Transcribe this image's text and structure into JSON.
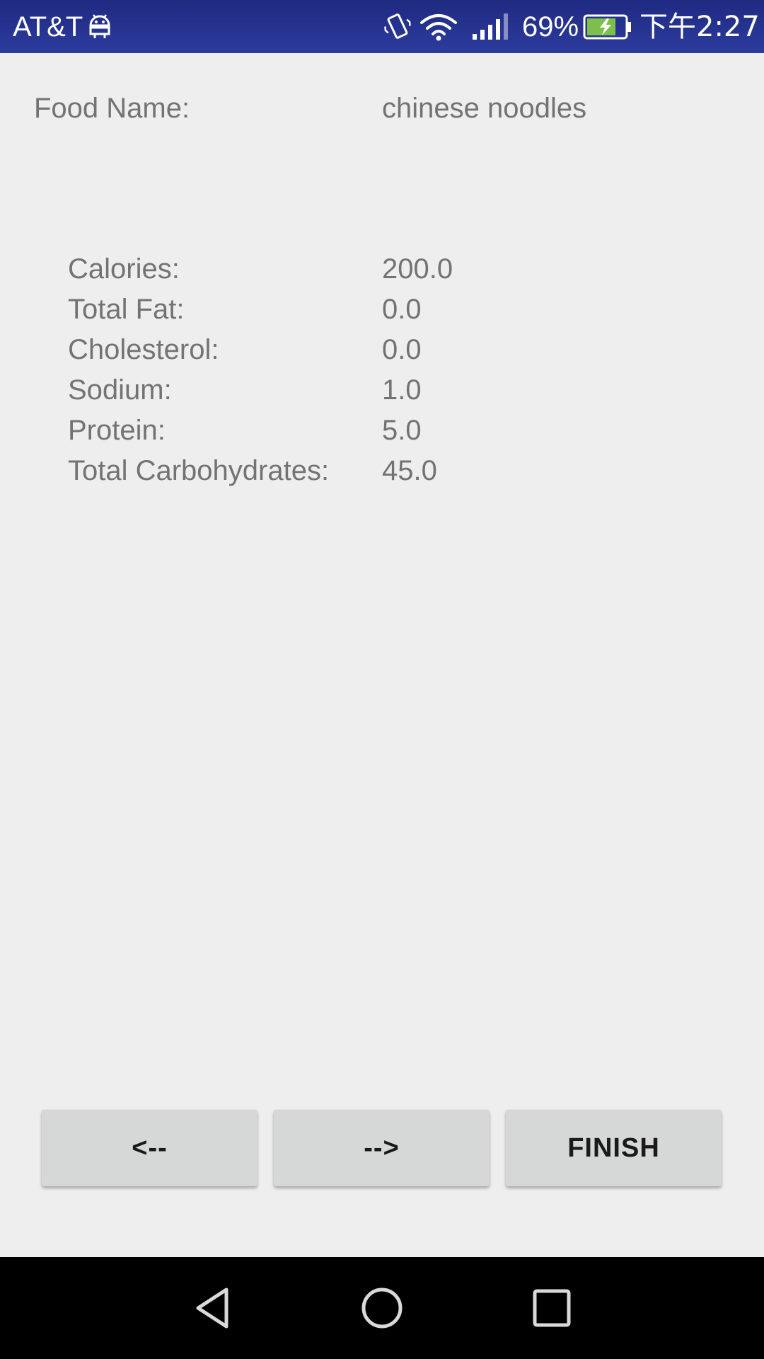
{
  "status_bar": {
    "carrier": "AT&T",
    "battery": "69%",
    "time": "下午2:27",
    "icons": [
      "android-icon",
      "vibrate-icon",
      "wifi-icon",
      "signal-icon",
      "battery-charging-icon"
    ],
    "battery_color": "#7cc04b"
  },
  "food": {
    "label": "Food Name:",
    "value": "chinese noodles"
  },
  "nutrients": [
    {
      "label": "Calories:",
      "value": "200.0"
    },
    {
      "label": "Total Fat:",
      "value": "0.0"
    },
    {
      "label": "Cholesterol:",
      "value": "0.0"
    },
    {
      "label": "Sodium:",
      "value": "1.0"
    },
    {
      "label": "Protein:",
      "value": "5.0"
    },
    {
      "label": "Total Carbohydrates:",
      "value": "45.0"
    }
  ],
  "buttons": {
    "prev": "<--",
    "next": "-->",
    "finish": "FINISH"
  },
  "nav_bar": {
    "icons": [
      "back-icon",
      "home-icon",
      "recents-icon"
    ]
  }
}
